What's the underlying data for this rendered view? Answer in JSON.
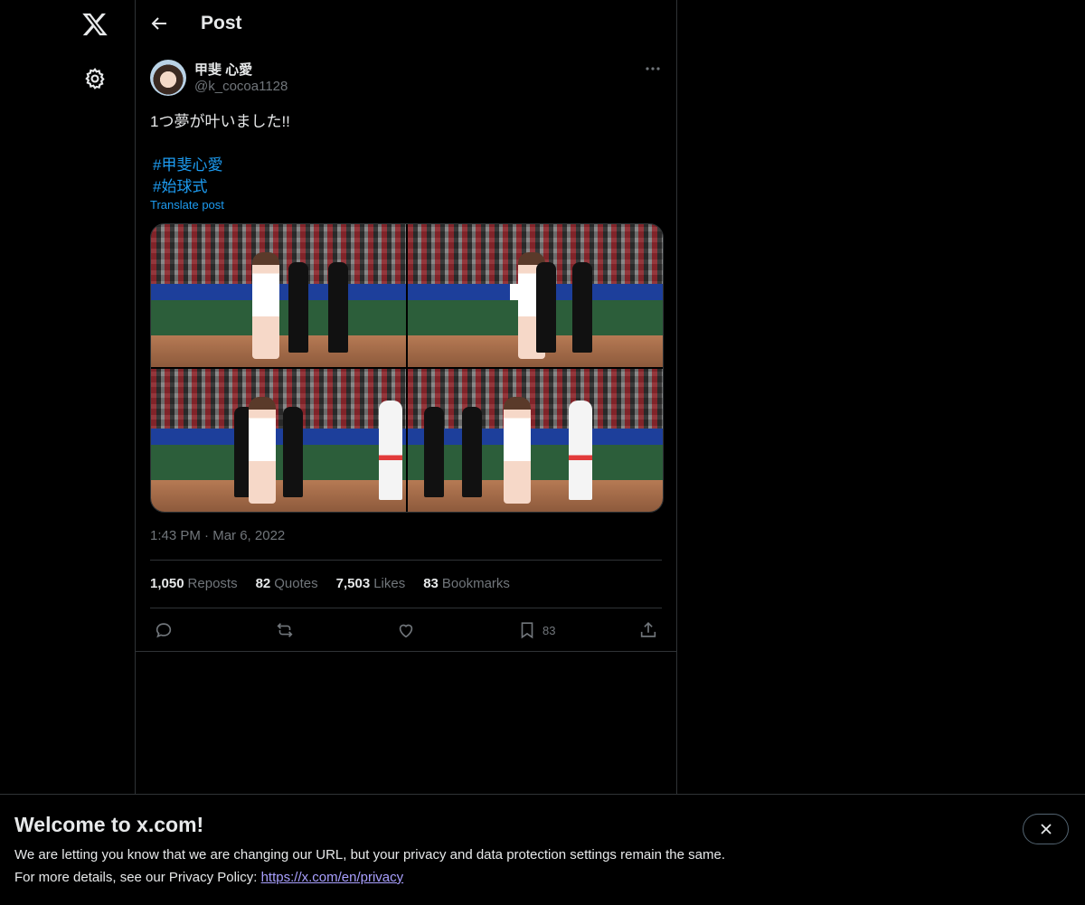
{
  "nav": {
    "logo_icon": "x-logo-icon",
    "settings_icon": "gear-icon"
  },
  "header": {
    "title": "Post",
    "back_icon": "arrow-left-icon"
  },
  "post": {
    "author_name": "甲斐 心愛",
    "author_handle": "@k_cocoa1128",
    "text": "1つ夢が叶いました!!",
    "hashtags": [
      "#甲斐心愛",
      "#始球式"
    ],
    "translate_label": "Translate post",
    "time": "1:43 PM",
    "date": "Mar 6, 2022",
    "stats": [
      {
        "num": "1,050",
        "label": "Reposts"
      },
      {
        "num": "82",
        "label": "Quotes"
      },
      {
        "num": "7,503",
        "label": "Likes"
      },
      {
        "num": "83",
        "label": "Bookmarks"
      }
    ],
    "bookmark_count": "83"
  },
  "banner": {
    "title": "Welcome to x.com!",
    "line1": "We are letting you know that we are changing our URL, but your privacy and data protection settings remain the same.",
    "line2_prefix": "For more details, see our Privacy Policy: ",
    "link_text": "https://x.com/en/privacy"
  },
  "colors": {
    "accent": "#1d9bf0",
    "background": "#000000",
    "muted": "#71767b"
  }
}
